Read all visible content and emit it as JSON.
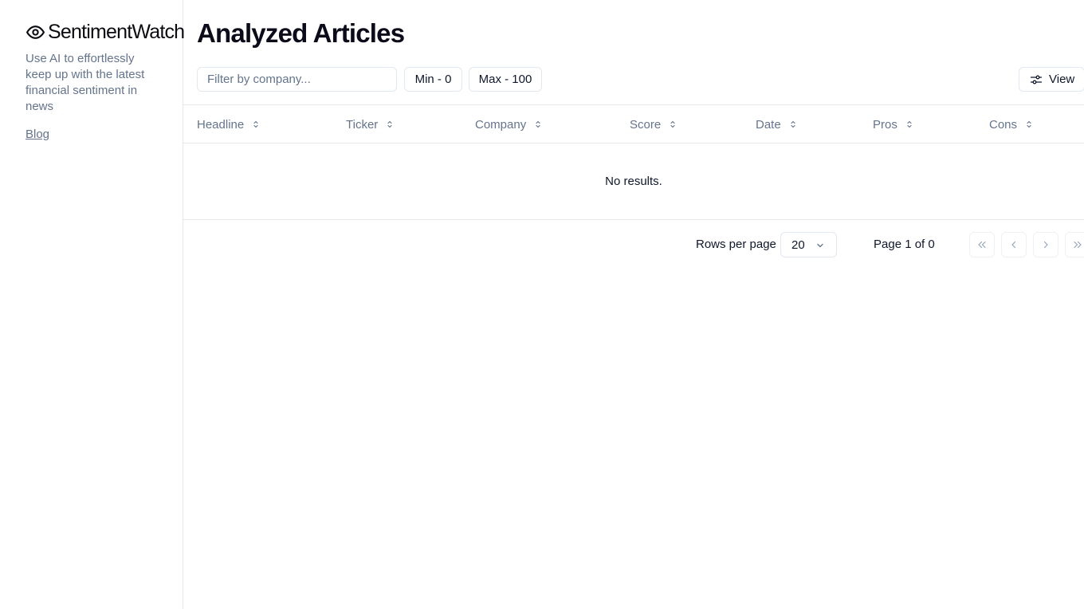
{
  "sidebar": {
    "brand": "SentimentWatch",
    "brand_icon": "eye-icon",
    "tagline": "Use AI to effortlessly keep up with the latest financial sentiment in news",
    "blog_link": "Blog"
  },
  "main": {
    "title": "Analyzed Articles",
    "filter": {
      "placeholder": "Filter by company...",
      "value": ""
    },
    "min_button": "Min - 0",
    "max_button": "Max - 100",
    "view_button": "View",
    "view_icon": "sliders-icon",
    "columns": [
      {
        "label": "Headline"
      },
      {
        "label": "Ticker"
      },
      {
        "label": "Company"
      },
      {
        "label": "Score"
      },
      {
        "label": "Date"
      },
      {
        "label": "Pros"
      },
      {
        "label": "Cons"
      }
    ],
    "empty_message": "No results.",
    "pagination": {
      "rows_per_page_label": "Rows per page",
      "rows_per_page_value": "20",
      "page_info": "Page 1 of 0",
      "buttons": [
        "first-page",
        "previous-page",
        "next-page",
        "last-page"
      ]
    }
  },
  "colors": {
    "text_primary": "#0f172a",
    "text_muted": "#64748b",
    "border": "#e2e8f0"
  }
}
